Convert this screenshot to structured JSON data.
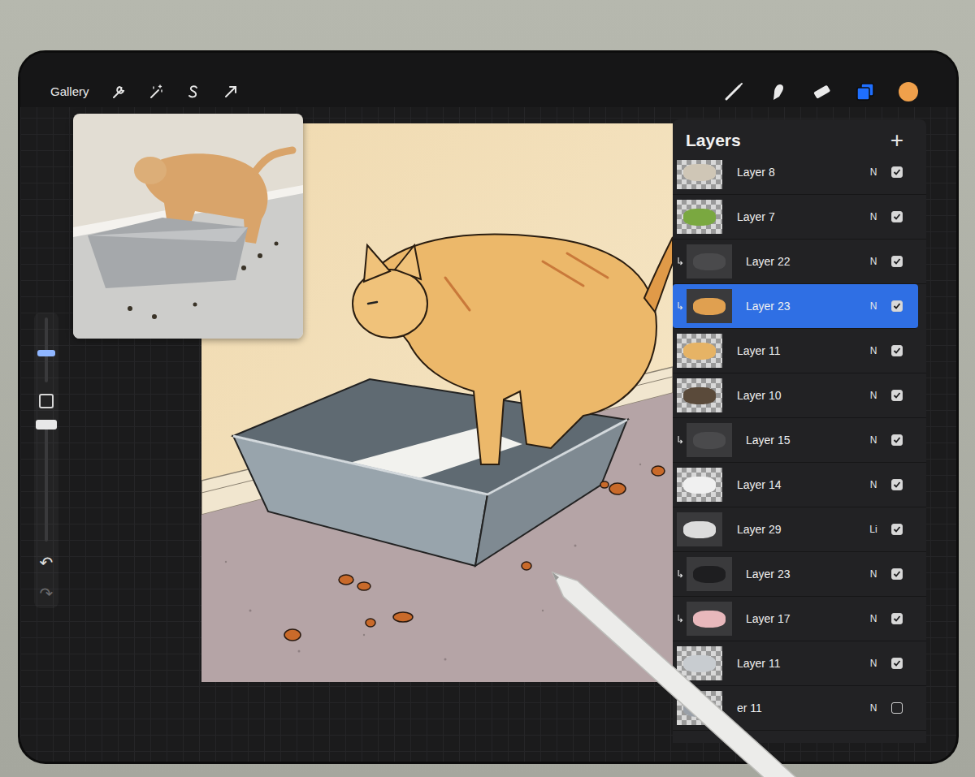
{
  "top_bar": {
    "gallery": "Gallery",
    "tools": [
      {
        "kind": "brush",
        "selected": false
      },
      {
        "kind": "smudge",
        "selected": false
      },
      {
        "kind": "eraser",
        "selected": false
      },
      {
        "kind": "layers",
        "selected": true
      }
    ],
    "current_color": "#f0a04b"
  },
  "sidebar": {
    "size_level": 0.45,
    "opacity_level": 1.0,
    "undo": "↶",
    "redo": "↷",
    "redo_disabled": true
  },
  "layers_panel": {
    "title": "Layers",
    "add": "+",
    "layers": [
      {
        "name": "Layer 8",
        "blend": "N",
        "visible": true,
        "selected": false,
        "clipped": false,
        "transparent": true,
        "color": "#cfc6b6"
      },
      {
        "name": "Layer 7",
        "blend": "N",
        "visible": true,
        "selected": false,
        "clipped": false,
        "transparent": true,
        "color": "#7aa840"
      },
      {
        "name": "Layer 22",
        "blend": "N",
        "visible": true,
        "selected": false,
        "clipped": true,
        "transparent": false,
        "color": "#4a4a4c"
      },
      {
        "name": "Layer 23",
        "blend": "N",
        "visible": true,
        "selected": true,
        "clipped": true,
        "transparent": false,
        "color": "#e0a050"
      },
      {
        "name": "Layer 11",
        "blend": "N",
        "visible": true,
        "selected": false,
        "clipped": false,
        "transparent": true,
        "color": "#e6b365"
      },
      {
        "name": "Layer 10",
        "blend": "N",
        "visible": true,
        "selected": false,
        "clipped": false,
        "transparent": true,
        "color": "#5a4a3a"
      },
      {
        "name": "Layer 15",
        "blend": "N",
        "visible": true,
        "selected": false,
        "clipped": true,
        "transparent": false,
        "color": "#4a4a4c"
      },
      {
        "name": "Layer 14",
        "blend": "N",
        "visible": true,
        "selected": false,
        "clipped": false,
        "transparent": true,
        "color": "#f0f0f0"
      },
      {
        "name": "Layer 29",
        "blend": "Li",
        "visible": true,
        "selected": false,
        "clipped": false,
        "transparent": false,
        "color": "#dcdcdc"
      },
      {
        "name": "Layer 23",
        "blend": "N",
        "visible": true,
        "selected": false,
        "clipped": true,
        "transparent": false,
        "color": "#1e1e20"
      },
      {
        "name": "Layer 17",
        "blend": "N",
        "visible": true,
        "selected": false,
        "clipped": true,
        "transparent": false,
        "color": "#e8b8bc"
      },
      {
        "name": "Layer 11",
        "blend": "N",
        "visible": true,
        "selected": false,
        "clipped": false,
        "transparent": true,
        "color": "#c8ccd0"
      },
      {
        "name": "er 11",
        "blend": "N",
        "visible": false,
        "selected": false,
        "clipped": false,
        "transparent": true,
        "color": "#9aa0a8"
      }
    ]
  }
}
